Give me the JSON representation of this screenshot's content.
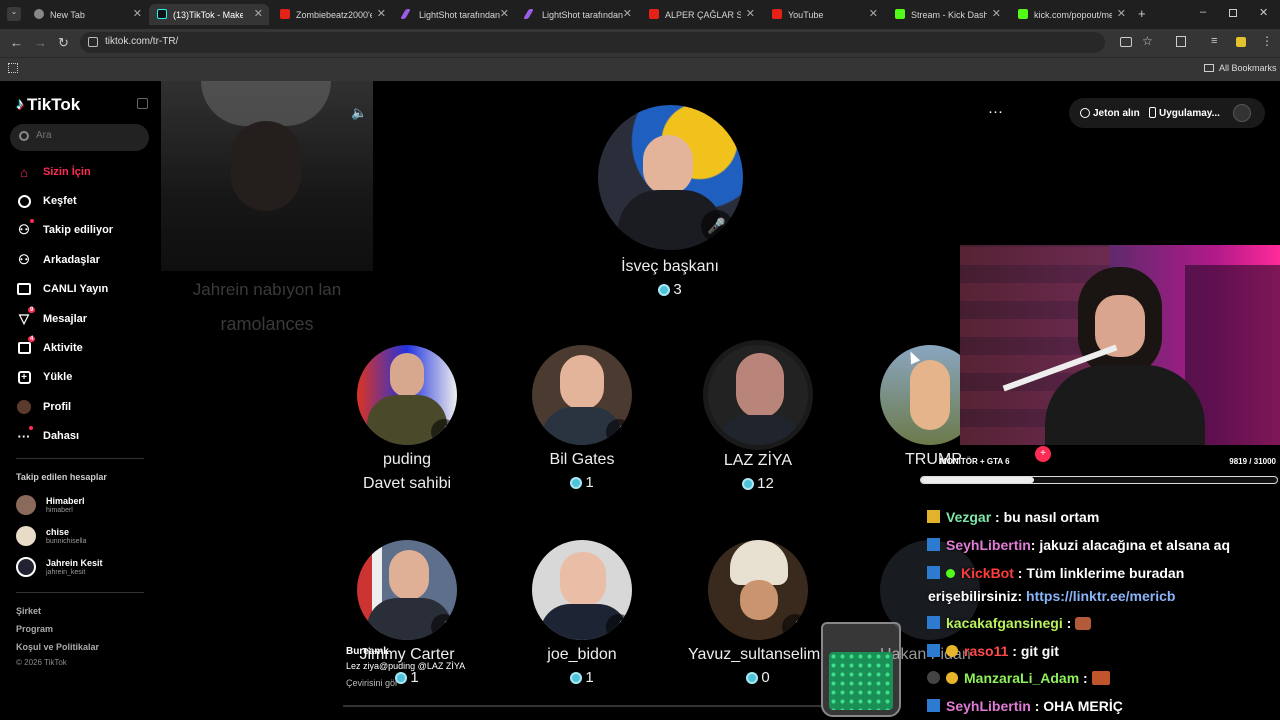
{
  "browser": {
    "tabs": [
      "New Tab",
      "(13)TikTok - Make Your Day",
      "Zombiebeatz2000'e Nasıl",
      "LightShot tarafından",
      "LightShot tarafından",
      "ALPER ÇAĞLAR SPOR",
      "YouTube",
      "Stream - Kick Dashboard",
      "kick.com/popout/mericb"
    ],
    "url": "tiktok.com/tr-TR/",
    "all_bookmarks": "All Bookmarks",
    "new_tab_symbol": "+"
  },
  "sidebar": {
    "logo": "TikTok",
    "search_placeholder": "Ara",
    "items": [
      {
        "label": "Sizin İçin",
        "icon": "home-icon",
        "active": true
      },
      {
        "label": "Keşfet",
        "icon": "compass-icon"
      },
      {
        "label": "Takip ediliyor",
        "icon": "following-icon"
      },
      {
        "label": "Arkadaşlar",
        "icon": "friends-icon"
      },
      {
        "label": "CANLI Yayın",
        "icon": "live-icon"
      },
      {
        "label": "Mesajlar",
        "icon": "messages-icon",
        "badge": "9"
      },
      {
        "label": "Aktivite",
        "icon": "activity-icon",
        "badge": "4"
      },
      {
        "label": "Yükle",
        "icon": "upload-icon"
      },
      {
        "label": "Profil",
        "icon": "profile-icon"
      },
      {
        "label": "Dahası",
        "icon": "more-icon"
      }
    ],
    "following_title": "Takip edilen hesaplar",
    "accounts": [
      {
        "name": "Himaberl",
        "username": "himaberl"
      },
      {
        "name": "chise",
        "username": "bunnichisella"
      },
      {
        "name": "Jahrein Kesit",
        "username": "jahrein_kesit"
      }
    ],
    "footer": [
      "Şirket",
      "Program",
      "Koşul ve Politikalar",
      "© 2026 TikTok"
    ]
  },
  "video": {
    "caption1": "Jahrein nabıyon lan",
    "caption2": "ramolances"
  },
  "header": {
    "get_coins": "Jeton alın",
    "get_app": "Uygulamay..."
  },
  "host": {
    "name": "İsveç başkanı",
    "count": "3"
  },
  "guests_row1": [
    {
      "name": "puding",
      "sub": "Davet sahibi"
    },
    {
      "name": "Bil Gates",
      "count": "1"
    },
    {
      "name": "LAZ ZİYA",
      "count": "12"
    },
    {
      "name": "TRUMP"
    }
  ],
  "guests_row2": [
    {
      "name": "Jimmy Carter",
      "count": "1"
    },
    {
      "name": "joe_bidon",
      "count": "1"
    },
    {
      "name": "Yavuz_sultanselim",
      "count": "0"
    },
    {
      "name": "Hakan Fidan"
    }
  ],
  "live_comment": {
    "user": "Bureamk",
    "text": "Lez ziya@puding @LAZ ZİYA",
    "translate": "Çevirisini gör"
  },
  "stream_overlay": {
    "goal_label": "MONİTÖR + GTA 6",
    "goal_progress": "9819 / 31000",
    "goal_fraction": 0.317
  },
  "chat": [
    {
      "user": "Vezgar",
      "color": "#7ee6a8",
      "text": ": bu nasıl ortam"
    },
    {
      "user": "SeyhLibertin",
      "color": "#e07bd6",
      "text": ": jakuzi alacağına et alsana aq"
    },
    {
      "user": "KickBot",
      "color": "#ff3b3b",
      "text": ": Tüm linklerime buradan"
    },
    {
      "user": "",
      "color": "#ffffff",
      "text": "erişebilirsiniz: ",
      "link": "https://linktr.ee/mericb"
    },
    {
      "user": "kacakafgansinegi",
      "color": "#b8f25c",
      "text": " :"
    },
    {
      "user": "raso11",
      "color": "#ff4a4a",
      "text": ": git git"
    },
    {
      "user": "ManzaraLi_Adam",
      "color": "#8ef05a",
      "text": " :"
    },
    {
      "user": "SeyhLibertin",
      "color": "#e07bd6",
      "text": ": OHA MERİÇ"
    }
  ]
}
